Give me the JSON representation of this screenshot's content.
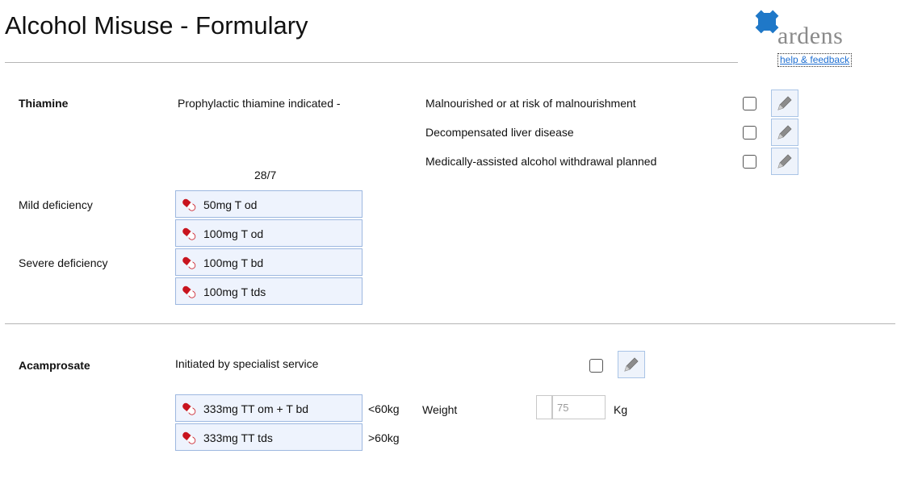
{
  "page": {
    "title": "Alcohol Misuse - Formulary",
    "brand": "ardens",
    "help_link": "help & feedback"
  },
  "thiamine": {
    "heading": "Thiamine",
    "indication": "Prophylactic thiamine indicated -",
    "duration": "28/7",
    "criteria": [
      {
        "label": "Malnourished or at risk of malnourishment"
      },
      {
        "label": "Decompensated liver disease"
      },
      {
        "label": "Medically-assisted alcohol withdrawal planned"
      }
    ],
    "mild_label": "Mild deficiency",
    "severe_label": "Severe deficiency",
    "doses": [
      {
        "label": "50mg T od"
      },
      {
        "label": "100mg T od"
      },
      {
        "label": "100mg T bd"
      },
      {
        "label": "100mg T tds"
      }
    ]
  },
  "acamprosate": {
    "heading": "Acamprosate",
    "initiated_label": "Initiated by specialist service",
    "doses": [
      {
        "label": "333mg TT om + T bd",
        "note": "<60kg"
      },
      {
        "label": "333mg TT tds",
        "note": ">60kg"
      }
    ],
    "weight_label": "Weight",
    "weight_placeholder": "75",
    "weight_unit": "Kg"
  },
  "colors": {
    "accent": "#1f78c8",
    "button_bg": "#eef3fd",
    "button_border": "#9db8e0",
    "pill_red": "#c8141e"
  },
  "icons": {
    "logo": "ardens-cross-logo",
    "edit": "pencil-icon",
    "drug": "capsule-icon"
  }
}
